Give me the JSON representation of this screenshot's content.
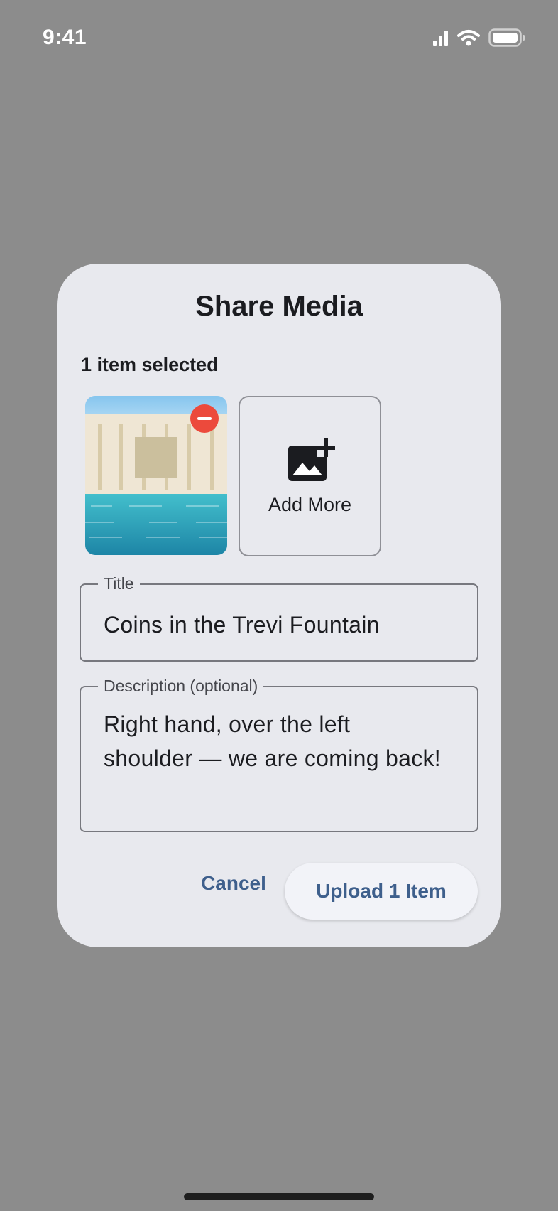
{
  "status_bar": {
    "time": "9:41",
    "icons": [
      "signal-icon",
      "wifi-icon",
      "battery-icon"
    ]
  },
  "dialog": {
    "title": "Share Media",
    "selection_count_text": "1 item selected",
    "media_items": [
      {
        "kind": "image",
        "thumbnail_icon": "fountain-photo-thumbnail",
        "remove_icon": "remove-icon"
      }
    ],
    "add_more": {
      "label": "Add More",
      "icon": "add-photo-icon"
    },
    "title_field": {
      "label": "Title",
      "value": "Coins in the Trevi Fountain"
    },
    "description_field": {
      "label": "Description (optional)",
      "value_lines": [
        "Right hand, over the left",
        "shoulder — we are coming back!"
      ]
    },
    "actions": {
      "cancel_label": "Cancel",
      "upload_label": "Upload 1 Item"
    }
  },
  "colors": {
    "backdrop": "#8c8c8c",
    "dialog_surface": "#e8e9ee",
    "accent_text": "#3e5f8c",
    "remove_badge": "#ec4a3c"
  }
}
